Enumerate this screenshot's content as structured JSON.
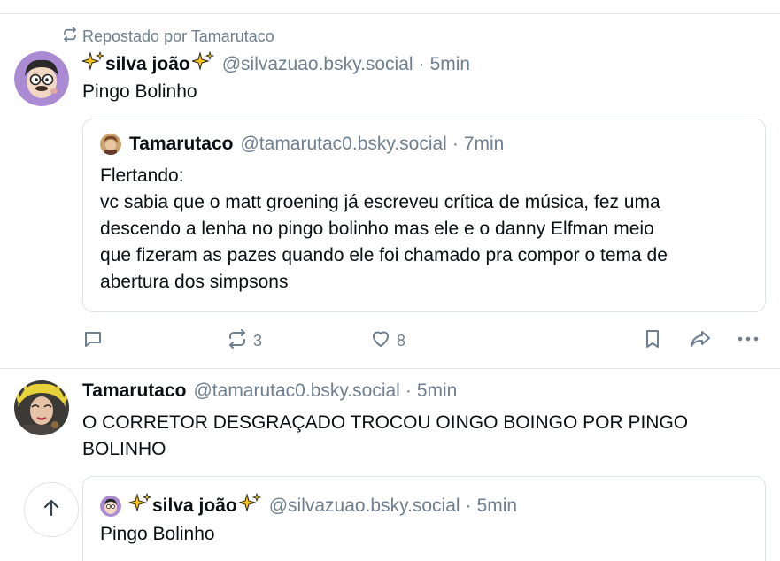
{
  "feed": {
    "post1": {
      "repost_label": "Repostado por Tamarutaco",
      "author_name": "silva joão",
      "author_handle": "@silvazuao.bsky.social",
      "time_sep": "·",
      "time": "5min",
      "text": "Pingo Bolinho",
      "quote": {
        "author_name": "Tamarutaco",
        "author_handle": "@tamarutac0.bsky.social",
        "time_sep": "·",
        "time": "7min",
        "text_lines": [
          "Flertando:",
          "vc sabia que o matt groening já escreveu crítica de música, fez uma",
          "descendo a lenha no pingo bolinho mas ele e o danny Elfman meio",
          "que fizeram as pazes quando ele foi chamado pra compor o tema de",
          "abertura dos simpsons"
        ]
      },
      "actions": {
        "reply_icon": "reply-bubble-icon",
        "repost_icon": "repost-icon",
        "repost_count": "3",
        "like_icon": "heart-icon",
        "like_count": "8",
        "bookmark_icon": "bookmark-icon",
        "share_icon": "share-arrow-icon",
        "more_icon": "more-dots-icon"
      }
    },
    "post2": {
      "author_name": "Tamarutaco",
      "author_handle": "@tamarutac0.bsky.social",
      "time_sep": "·",
      "time": "5min",
      "text_lines": [
        "O CORRETOR DESGRAÇADO TROCOU OINGO BOINGO POR PINGO",
        "BOLINHO"
      ],
      "quote": {
        "author_name": "silva joão",
        "author_handle": "@silvazuao.bsky.social",
        "time_sep": "·",
        "time": "5min",
        "text": "Pingo Bolinho"
      }
    }
  },
  "colors": {
    "muted": "#6f7f8f",
    "border": "#dfe4e9",
    "sparkle": "#f5c518"
  },
  "scroll_top_icon": "arrow-up-icon"
}
